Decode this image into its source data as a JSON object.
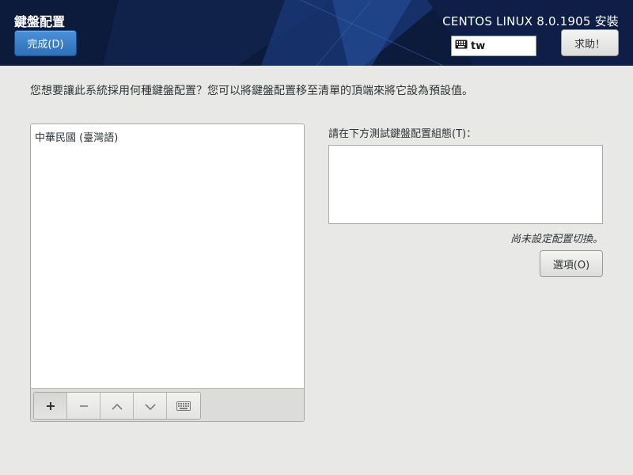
{
  "header": {
    "page_title": "鍵盤配置",
    "done_label": "完成(D)",
    "product_title": "CENTOS LINUX 8.0.1905 安裝",
    "keyboard_indicator": "tw",
    "help_label": "求助！"
  },
  "main": {
    "instructions": "您想要讓此系統採用何種鍵盤配置？您可以將鍵盤配置移至清單的頂端來將它設為預設值。",
    "layouts": [
      "中華民國 (臺灣語)"
    ],
    "toolbar": [
      "add-icon",
      "remove-icon",
      "move-up-icon",
      "move-down-icon",
      "keyboard-preview-icon"
    ],
    "test_label": "請在下方測試鍵盤配置組態(T)：",
    "test_value": "",
    "switch_note": "尚未設定配置切換。",
    "options_label": "選項(O)"
  },
  "colors": {
    "header_bg": "#0c1a3c",
    "accent": "#3b82d0",
    "body_bg": "#e8e8e7"
  }
}
